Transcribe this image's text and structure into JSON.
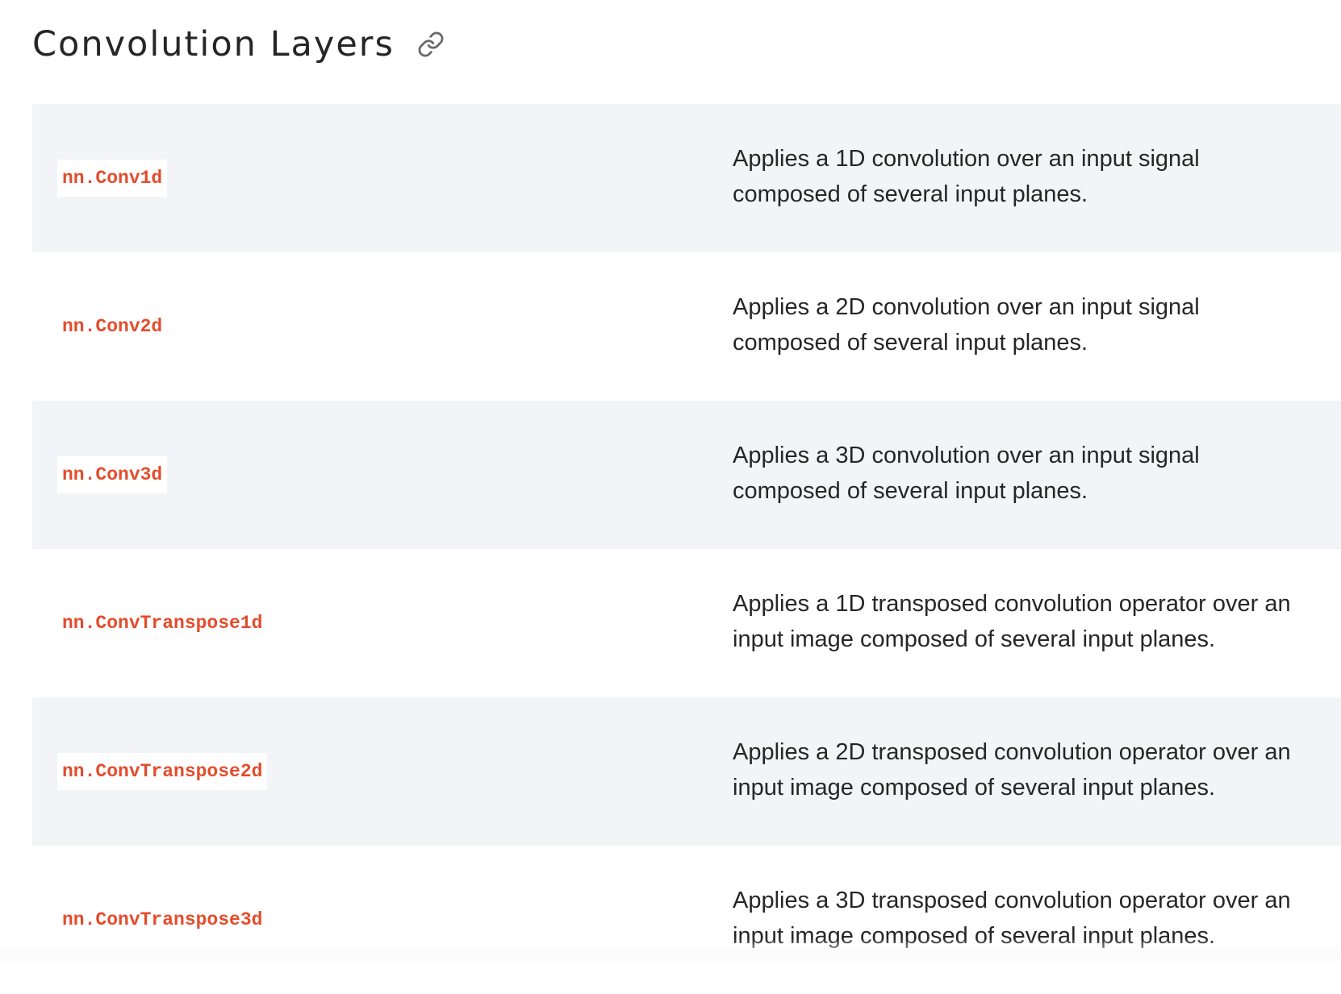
{
  "section": {
    "title": "Convolution Layers",
    "anchor_icon": "link-icon"
  },
  "colors": {
    "code_text": "#e44c2c",
    "row_shaded": "#f3f4f7",
    "row_plain": "#ffffff",
    "body_text": "#262626"
  },
  "rows": [
    {
      "name": "nn.Conv1d",
      "description": "Applies a 1D convolution over an input signal composed of several input planes."
    },
    {
      "name": "nn.Conv2d",
      "description": "Applies a 2D convolution over an input signal composed of several input planes."
    },
    {
      "name": "nn.Conv3d",
      "description": "Applies a 3D convolution over an input signal composed of several input planes."
    },
    {
      "name": "nn.ConvTranspose1d",
      "description": "Applies a 1D transposed convolution operator over an input image composed of several input planes."
    },
    {
      "name": "nn.ConvTranspose2d",
      "description": "Applies a 2D transposed convolution operator over an input image composed of several input planes."
    },
    {
      "name": "nn.ConvTranspose3d",
      "description": "Applies a 3D transposed convolution operator over an input image composed of several input planes."
    }
  ]
}
